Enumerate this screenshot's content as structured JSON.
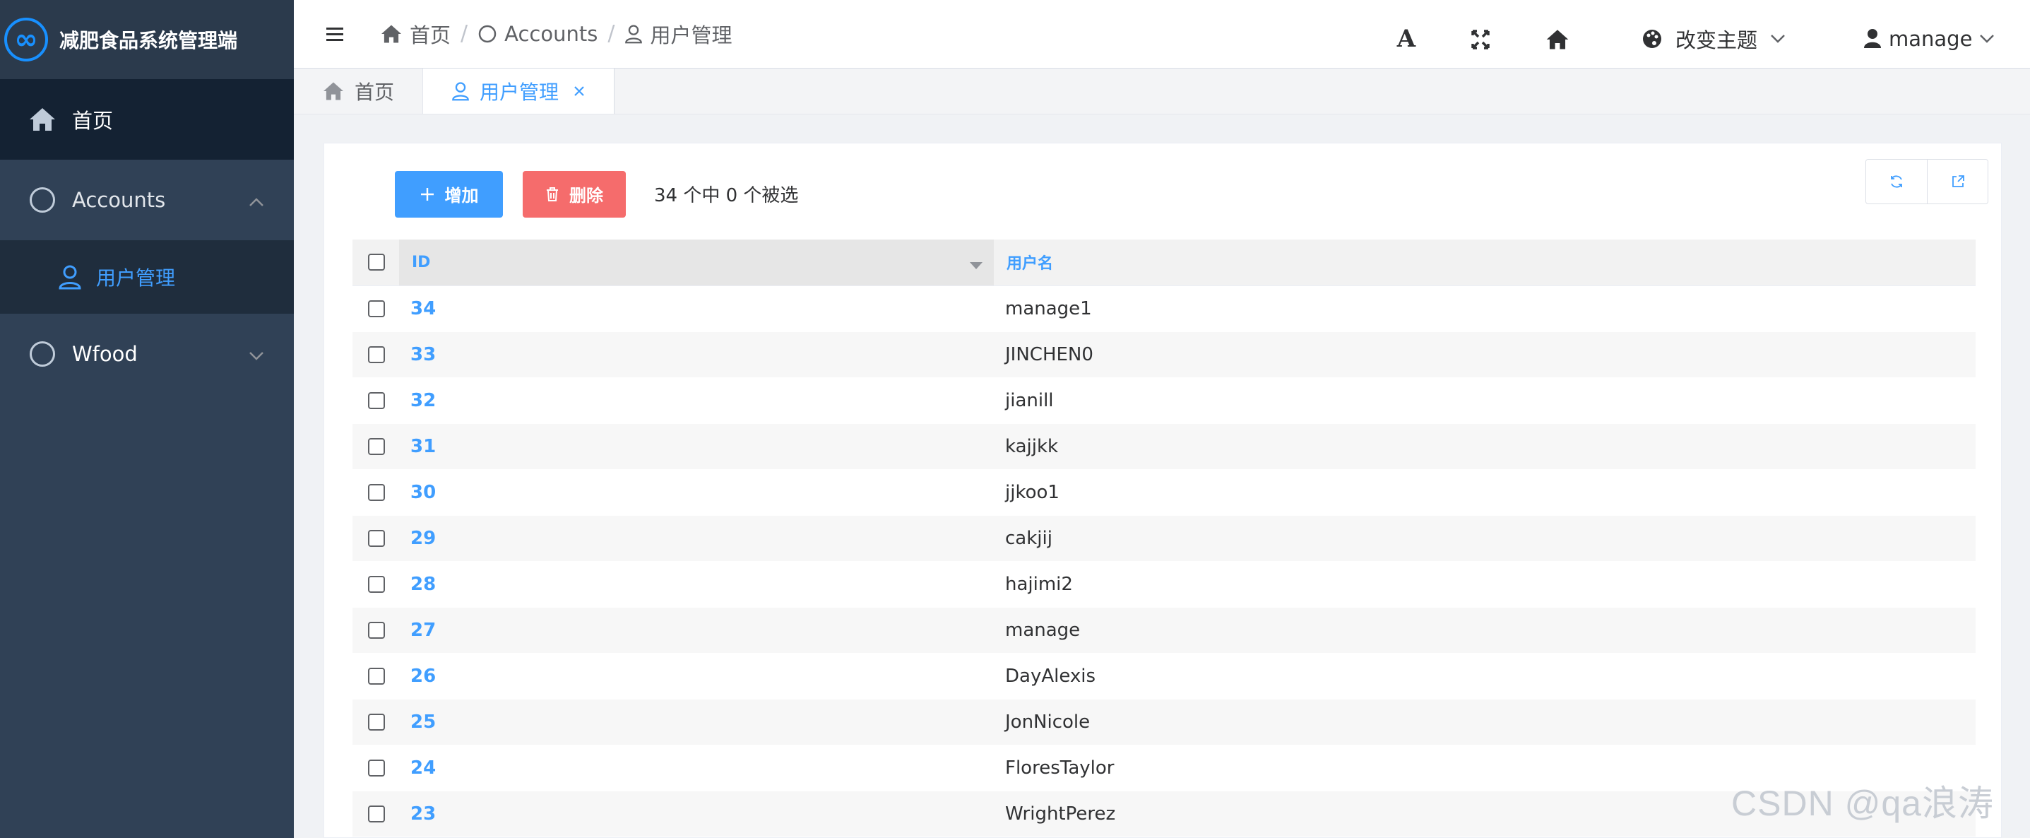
{
  "sidebar": {
    "logo_text": "减肥食品系统管理端",
    "items": [
      {
        "label": "首页"
      },
      {
        "label": "Accounts"
      },
      {
        "label": "用户管理"
      },
      {
        "label": "Wfood"
      }
    ]
  },
  "navbar": {
    "breadcrumb": [
      "首页",
      "Accounts",
      "用户管理"
    ],
    "breadcrumb_sep": "/",
    "theme_label": "改变主题",
    "user_label": "manage"
  },
  "tags": [
    {
      "label": "首页"
    },
    {
      "label": "用户管理"
    }
  ],
  "toolbar": {
    "add_label": "增加",
    "delete_label": "删除",
    "selection_text": "34 个中 0 个被选"
  },
  "table": {
    "headers": {
      "id": "ID",
      "username": "用户名"
    },
    "rows": [
      {
        "id": "34",
        "username": "manage1"
      },
      {
        "id": "33",
        "username": "JINCHEN0"
      },
      {
        "id": "32",
        "username": "jianill"
      },
      {
        "id": "31",
        "username": "kajjkk"
      },
      {
        "id": "30",
        "username": "jjkoo1"
      },
      {
        "id": "29",
        "username": "cakjij"
      },
      {
        "id": "28",
        "username": "hajimi2"
      },
      {
        "id": "27",
        "username": "manage"
      },
      {
        "id": "26",
        "username": "DayAlexis"
      },
      {
        "id": "25",
        "username": "JonNicole"
      },
      {
        "id": "24",
        "username": "FloresTaylor"
      },
      {
        "id": "23",
        "username": "WrightPerez"
      }
    ]
  },
  "watermark": "CSDN @qa浪涛",
  "colors": {
    "primary": "#409eff",
    "danger": "#f56c6c",
    "sidebar": "#304156"
  }
}
